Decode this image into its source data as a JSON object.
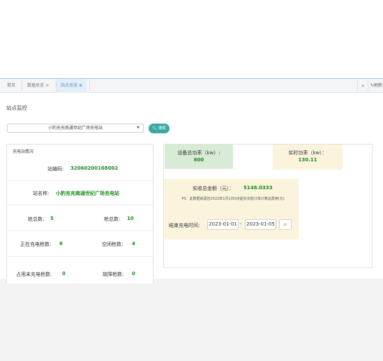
{
  "tabs": [
    {
      "label": "首页",
      "closable": false,
      "active": false
    },
    {
      "label": "数据总览",
      "closable": true,
      "active": false
    },
    {
      "label": "站点总览",
      "closable": true,
      "active": true
    }
  ],
  "toolbar": {
    "forward_icon": "double-chevron-right-icon",
    "refresh_label": "刷新"
  },
  "page_title": "站点监控",
  "station_select": {
    "selected": "小豹充充南通世纪广场充电站"
  },
  "search_button": {
    "label": "搜索"
  },
  "station_info": {
    "title": "充电站情况",
    "code_label": "站编码:",
    "code_value": "32060200168002",
    "name_label": "站名称:",
    "name_value": "小豹充充南通世纪广场充电站",
    "pile_count_label": "桩总数:",
    "pile_count_value": "5",
    "gun_count_label": "枪总数:",
    "gun_count_value": "10",
    "charging_label": "正在充电枪数:",
    "charging_value": "6",
    "idle_label": "空闲枪数:",
    "idle_value": "4",
    "occupied_label": "占用未充电枪数:",
    "occupied_value": "0",
    "fault_label": "故障枪数:",
    "fault_value": "0"
  },
  "power": {
    "device_total_label": "设备总功率（kw）:",
    "device_total_value": "600",
    "realtime_label": "实时功率（kw）：",
    "realtime_value": "130.11"
  },
  "revenue": {
    "amount_label": "实收总金额（元）：",
    "amount_value": "5148.0333",
    "note": "PS：此数据来源自2022年1月1日0点起实充桩订单计算总费用(元)",
    "end_time_label": "结束充电时间:",
    "date_from": "2023-01-01",
    "date_sep": "-",
    "date_to": "2023-01-05"
  },
  "colors": {
    "accent": "#3aa99f",
    "value_green": "#1f8a1f",
    "green_card": "#d7ebd5",
    "yellow_card": "#faf4dd",
    "tab_active": "#4a90d0"
  }
}
